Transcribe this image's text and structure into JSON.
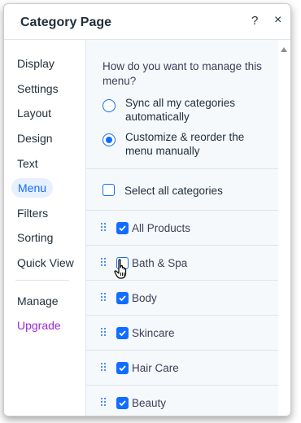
{
  "panel": {
    "title": "Category Page",
    "help": "?",
    "close": "×"
  },
  "nav": {
    "items": [
      {
        "label": "Display"
      },
      {
        "label": "Settings"
      },
      {
        "label": "Layout"
      },
      {
        "label": "Design"
      },
      {
        "label": "Text"
      },
      {
        "label": "Menu",
        "active": true
      },
      {
        "label": "Filters"
      },
      {
        "label": "Sorting"
      },
      {
        "label": "Quick View"
      }
    ],
    "manage": "Manage",
    "upgrade": "Upgrade"
  },
  "menu": {
    "question": "How do you want to manage this menu?",
    "options": [
      {
        "label": "Sync all my categories automatically",
        "selected": false
      },
      {
        "label": "Customize & reorder the menu manually",
        "selected": true
      }
    ],
    "select_all": {
      "label": "Select all categories",
      "checked": false
    },
    "categories": [
      {
        "label": "All Products",
        "checked": true
      },
      {
        "label": "Bath & Spa",
        "checked": false
      },
      {
        "label": "Body",
        "checked": true
      },
      {
        "label": "Skincare",
        "checked": true
      },
      {
        "label": "Hair Care",
        "checked": true
      },
      {
        "label": "Beauty",
        "checked": true
      }
    ]
  },
  "colors": {
    "accent": "#116dff",
    "upgrade": "#9a27d5",
    "content_bg": "#f6f9fc"
  }
}
